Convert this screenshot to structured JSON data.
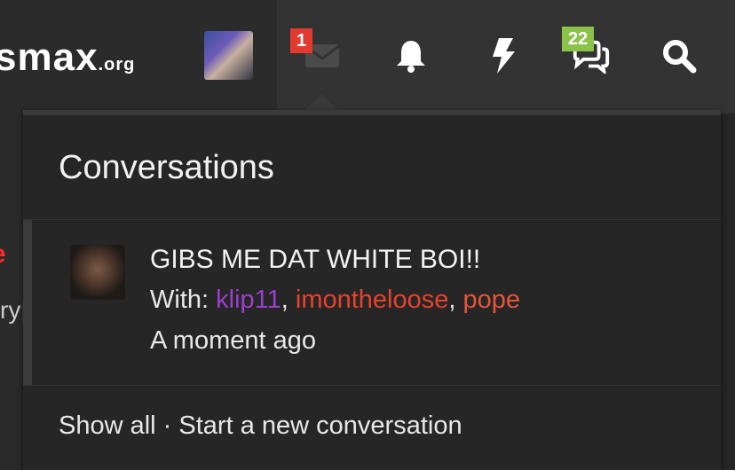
{
  "header": {
    "logo_main": "smax",
    "logo_tld": ".org",
    "icons": [
      "avatar",
      "envelope-icon",
      "bell-icon",
      "bolt-icon",
      "chat-icon",
      "search-icon"
    ],
    "badges": {
      "inbox": "1",
      "chat": "22"
    }
  },
  "background": {
    "red_fragment": "e",
    "text_fragment": "ry|"
  },
  "dropdown": {
    "title": "Conversations",
    "conversation": {
      "title": "GIBS ME DAT WHITE BOI!!",
      "with_label": "With:",
      "participants": [
        "klip11",
        "imontheloose",
        "pope"
      ],
      "separator": ",",
      "time": "A moment ago"
    },
    "footer": {
      "show_all": "Show all",
      "dot": " · ",
      "start_new": "Start a new conversation"
    }
  },
  "colors": {
    "badge_red": "#e23a2e",
    "badge_green": "#8bc34a",
    "user_purple": "#9b3fcf",
    "user_red": "#e8412c"
  }
}
